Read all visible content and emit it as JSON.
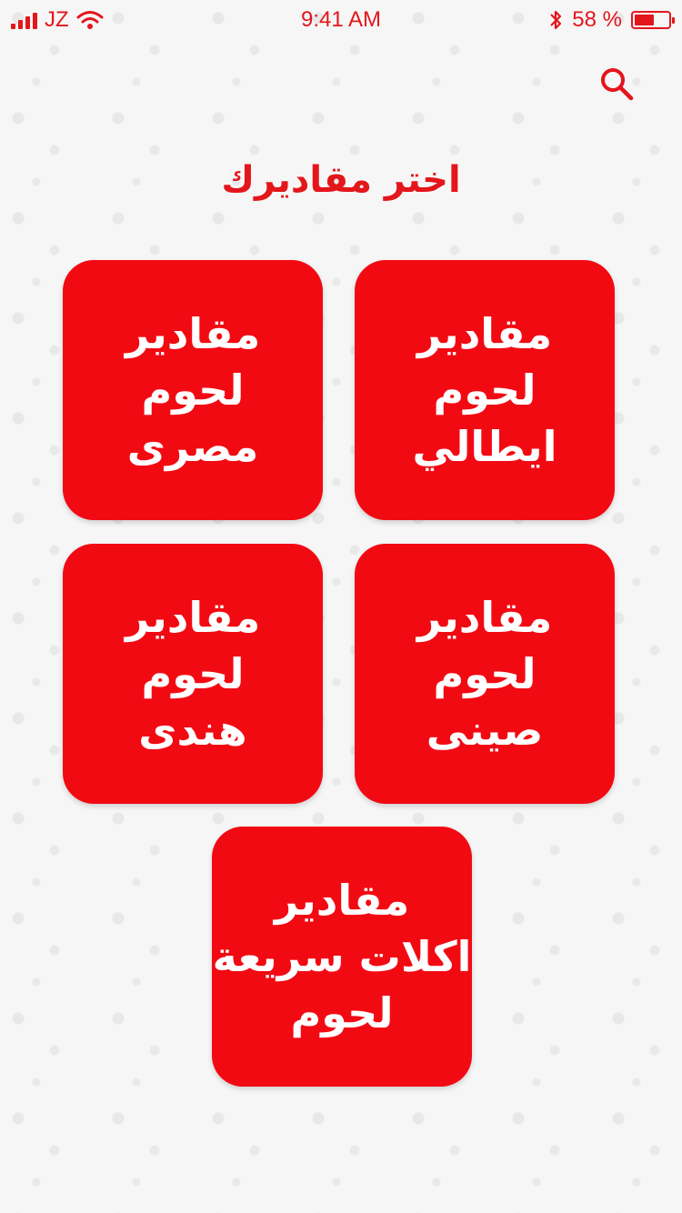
{
  "status_bar": {
    "carrier": "JZ",
    "time": "9:41 AM",
    "battery_percent": "58 %",
    "battery_level": 0.58
  },
  "header": {
    "title": "اختر مقاديرك"
  },
  "icons": {
    "search": "search-icon",
    "wifi": "wifi-icon",
    "bluetooth": "bluetooth-icon",
    "signal": "signal-icon",
    "battery": "battery-icon"
  },
  "colors": {
    "accent": "#f20a13",
    "status": "#e3161c",
    "tile_text": "#ffffff"
  },
  "tiles": [
    {
      "label": "مقادير\nلحوم\nايطالي"
    },
    {
      "label": "مقادير\nلحوم\nمصرى"
    },
    {
      "label": "مقادير\nلحوم\nصينى"
    },
    {
      "label": "مقادير\nلحوم\nهندى"
    },
    {
      "label": "مقادير\nاكلات سريعة\nلحوم"
    }
  ]
}
